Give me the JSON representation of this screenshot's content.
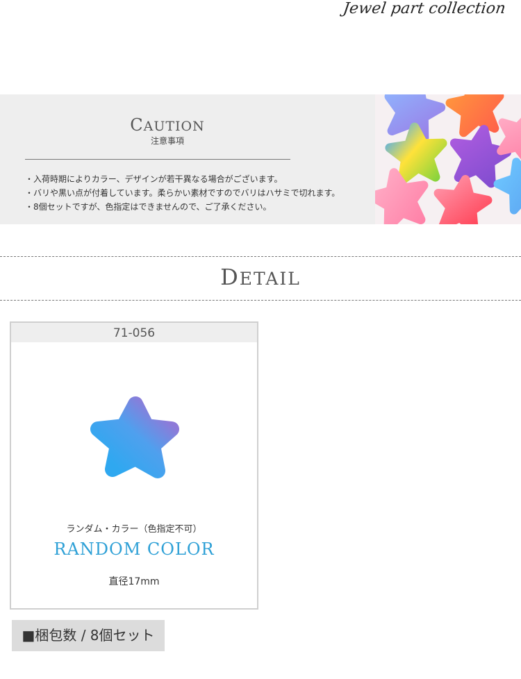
{
  "brand": {
    "text": "Jewel part collection"
  },
  "caution": {
    "title_first": "C",
    "title_rest": "AUTION",
    "subtitle": "注意事項",
    "items": [
      "・入荷時期によりカラー、デザインが若干異なる場合がございます。",
      "・バリや黒い点が付着しています。柔らかい素材ですのでバリはハサミで切れます。",
      "・8個セットですが、色指定はできませんので、ご了承ください。"
    ]
  },
  "detail": {
    "title_first": "D",
    "title_rest": "ETAIL"
  },
  "product": {
    "code": "71-056",
    "label_jp": "ランダム・カラー（色指定不可）",
    "label_en": "RANDOM COLOR",
    "size": "直径17mm",
    "accent_color": "#2ea0d6"
  },
  "package": {
    "text": "■梱包数 / 8個セット"
  }
}
